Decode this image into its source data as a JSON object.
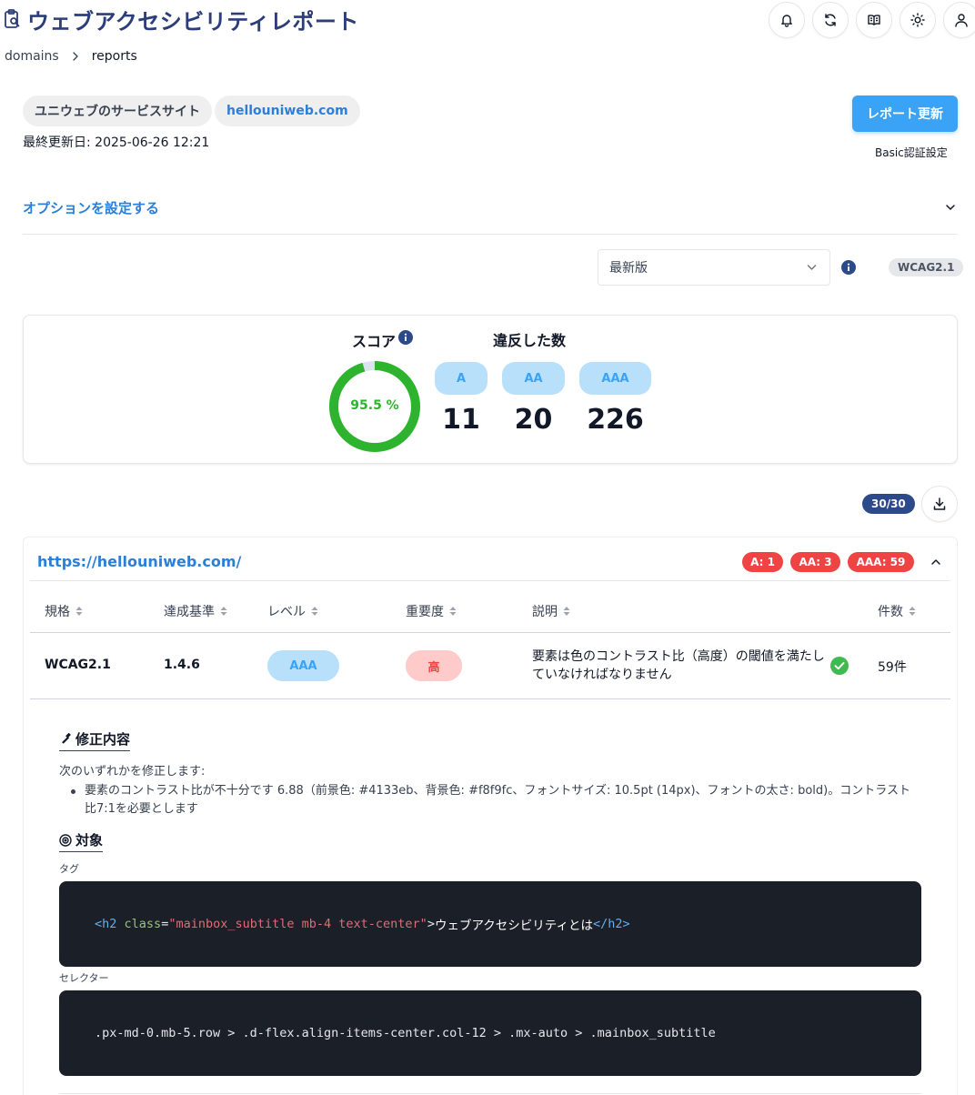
{
  "header": {
    "title": "ウェブアクセシビリティレポート",
    "icons": [
      "bell-icon",
      "refresh-icon",
      "book-icon",
      "sun-icon",
      "user-icon"
    ]
  },
  "breadcrumb": {
    "items": [
      "domains",
      "reports"
    ]
  },
  "site": {
    "name": "ユニウェブのサービスサイト",
    "domain": "hellouniweb.com",
    "last_updated": "最終更新日: 2025-06-26 12:21"
  },
  "actions": {
    "refresh_label": "レポート更新",
    "basic_auth_label": "Basic認証設定"
  },
  "options": {
    "toggle_label": "オプションを設定する"
  },
  "version": {
    "selected": "最新版",
    "standard": "WCAG2.1"
  },
  "score": {
    "title": "スコア",
    "value": "95.5 %",
    "percent": 95.5,
    "violations_title": "違反した数",
    "levels": [
      {
        "label": "A",
        "count": "11"
      },
      {
        "label": "AA",
        "count": "20"
      },
      {
        "label": "AAA",
        "count": "226"
      }
    ]
  },
  "pagination": {
    "count": "30/30"
  },
  "page_result": {
    "url": "https://hellouniweb.com/",
    "badges": [
      "A: 1",
      "AA: 3",
      "AAA: 59"
    ],
    "columns": [
      "規格",
      "達成基準",
      "レベル",
      "重要度",
      "説明",
      "件数"
    ],
    "row": {
      "standard": "WCAG2.1",
      "criterion": "1.4.6",
      "level": "AAA",
      "severity": "高",
      "description": "要素は色のコントラスト比（高度）の閾値を満たしていなければなりません",
      "count": "59件"
    },
    "fix": {
      "title": "修正内容",
      "intro": "次のいずれかを修正します:",
      "item": "要素のコントラスト比が不十分です 6.88（前景色: #4133eb、背景色: #f8f9fc、フォントサイズ: 10.5pt (14px)、フォントの太さ: bold)。コントラスト比7:1を必要とします"
    },
    "target": {
      "title": "対象",
      "tag_label": "タグ",
      "tag_code": {
        "open_bracket": "<",
        "tag": "h2",
        "attr": "class",
        "eq": "=",
        "value": "\"mainbox_subtitle mb-4 text-center\"",
        "close_bracket": ">",
        "text": "ウェブアクセシビリティとは",
        "end_tag": "</h2>"
      },
      "selector_label": "セレクター",
      "selector_code": ".px-md-0.mb-5.row > .d-flex.align-items-center.col-12 > .mx-auto > .mainbox_subtitle"
    }
  },
  "colors": {
    "brand": "#2c3e7a",
    "link": "#2b7fd8",
    "accent": "#3aa3f5",
    "score_green": "#2db32d",
    "danger": "#ef4444"
  }
}
